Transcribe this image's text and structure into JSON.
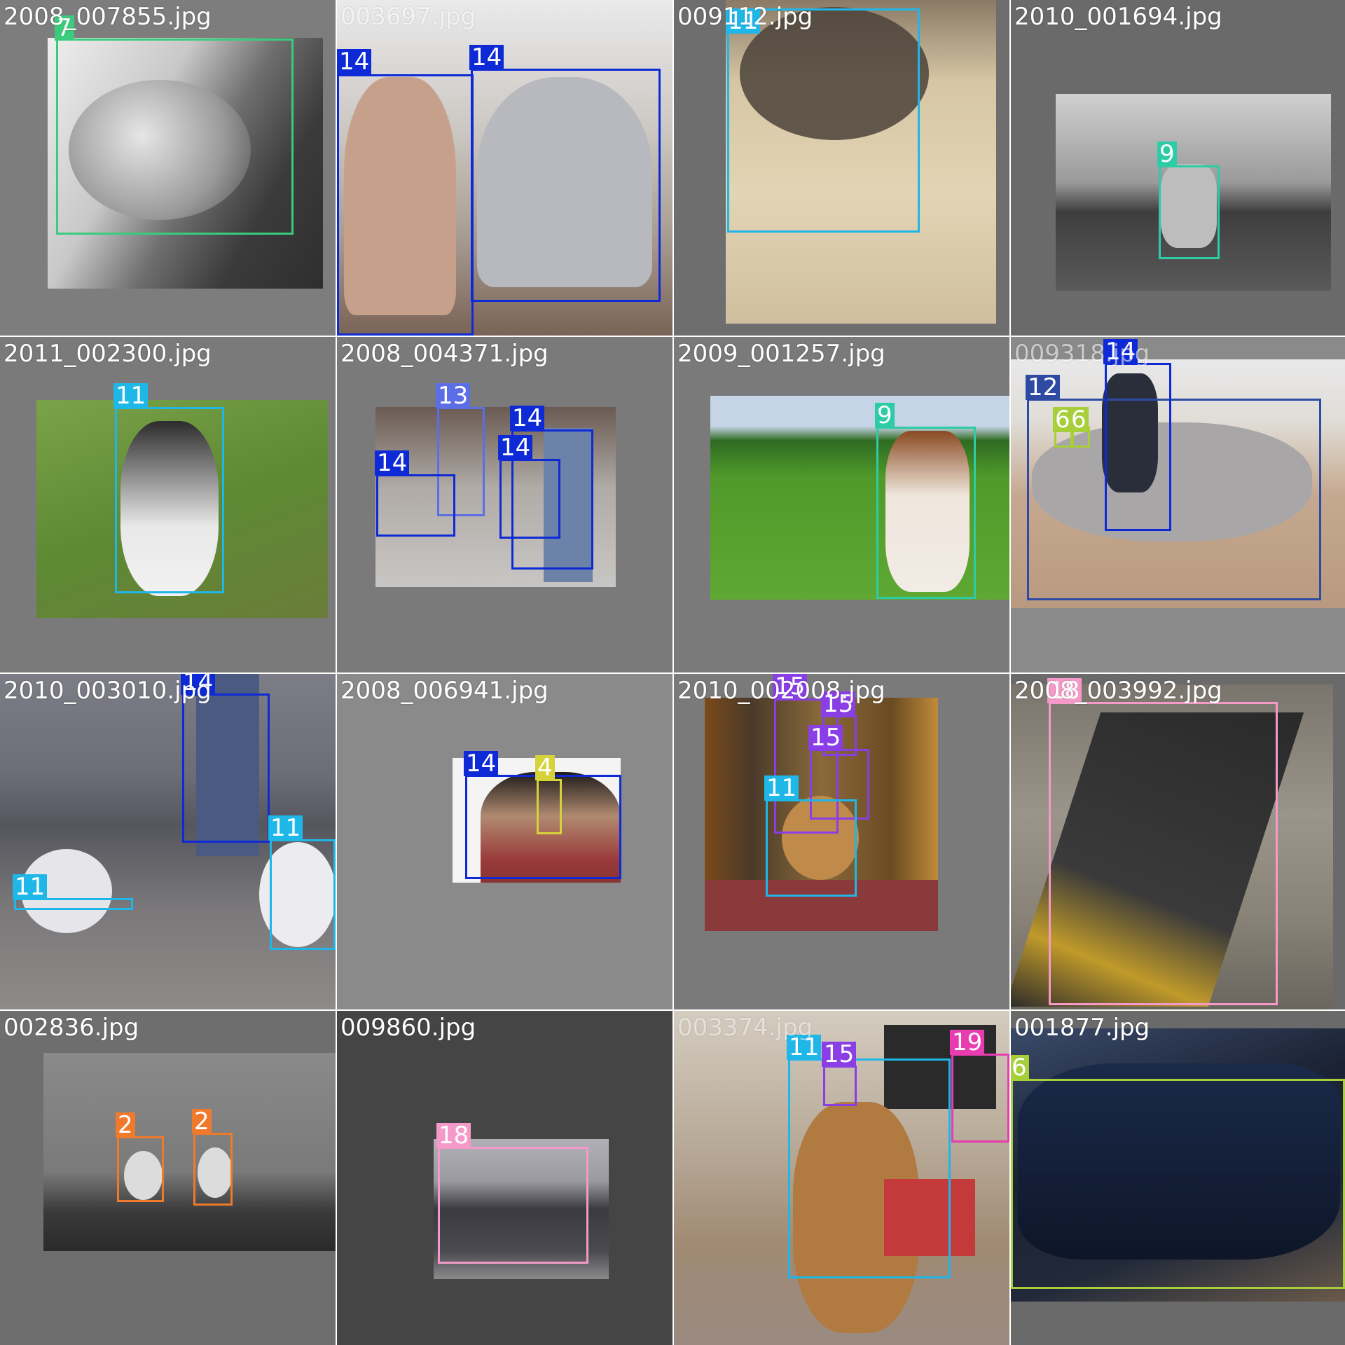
{
  "colors": {
    "c2": "#f07a2c",
    "c4": "#d6d23a",
    "c6": "#a6cf3a",
    "c7": "#3ccb7c",
    "c9": "#2ecca6",
    "c11": "#1fb6e8",
    "c12": "#2e4aa3",
    "c13": "#5b6ee6",
    "c14": "#0d2ad6",
    "c15": "#8a3ee6",
    "c18": "#f59ac8",
    "c19": "#e83cb0"
  },
  "tiles": [
    {
      "filename": "2008_007855.jpg",
      "bg": "#7d7d7d",
      "photo": {
        "desc": "cat-closeup",
        "fill": "#bdbdbd"
      },
      "boxes": [
        {
          "label": "7",
          "color": "c7"
        }
      ]
    },
    {
      "filename": "003697.jpg",
      "bg": "#d8dadc",
      "photo": {
        "desc": "two-people-at-table",
        "fill": "#c9c2bb"
      },
      "boxes": [
        {
          "label": "14",
          "color": "c14"
        },
        {
          "label": "14",
          "color": "c14"
        }
      ]
    },
    {
      "filename": "009112.jpg",
      "bg": "#6e6e6e",
      "photo": {
        "desc": "dog-on-bed",
        "fill": "#d9c9a8"
      },
      "boxes": [
        {
          "label": "11",
          "color": "c11"
        }
      ]
    },
    {
      "filename": "2010_001694.jpg",
      "bg": "#6a6a6a",
      "photo": {
        "desc": "cow-in-field-bw",
        "fill": "#8e8e8e"
      },
      "boxes": [
        {
          "label": "9",
          "color": "c9"
        }
      ]
    },
    {
      "filename": "2011_002300.jpg",
      "bg": "#7a7a7a",
      "photo": {
        "desc": "husky-on-grass",
        "fill": "#6b8e3c"
      },
      "boxes": [
        {
          "label": "11",
          "color": "c11"
        }
      ]
    },
    {
      "filename": "2008_004371.jpg",
      "bg": "#7a7a7a",
      "photo": {
        "desc": "motorbike-street",
        "fill": "#9a9a9a"
      },
      "boxes": [
        {
          "label": "13",
          "color": "c13"
        },
        {
          "label": "14",
          "color": "c14"
        },
        {
          "label": "14",
          "color": "c14"
        },
        {
          "label": "14",
          "color": "c14"
        }
      ]
    },
    {
      "filename": "2009_001257.jpg",
      "bg": "#7a7a7a",
      "photo": {
        "desc": "cow-in-green-field",
        "fill": "#4f8a2a"
      },
      "boxes": [
        {
          "label": "9",
          "color": "c9"
        }
      ]
    },
    {
      "filename": "009318.jpg",
      "bg": "#8a8a8a",
      "photo": {
        "desc": "rider-on-horse",
        "fill": "#b89a82"
      },
      "boxes": [
        {
          "label": "14",
          "color": "c14"
        },
        {
          "label": "12",
          "color": "c12"
        },
        {
          "label": "6",
          "color": "c6"
        },
        {
          "label": "6",
          "color": "c6"
        }
      ]
    },
    {
      "filename": "2010_003010.jpg",
      "bg": "#5f6068",
      "photo": {
        "desc": "beach-dogs",
        "fill": "#6f6f78"
      },
      "boxes": [
        {
          "label": "14",
          "color": "c14"
        },
        {
          "label": "11",
          "color": "c11"
        },
        {
          "label": "11",
          "color": "c11"
        }
      ]
    },
    {
      "filename": "2008_006941.jpg",
      "bg": "#8a8a8a",
      "photo": {
        "desc": "man-with-bottle",
        "fill": "#f4f4f4"
      },
      "boxes": [
        {
          "label": "14",
          "color": "c14"
        },
        {
          "label": "4",
          "color": "c4"
        }
      ]
    },
    {
      "filename": "2010_002008.jpg",
      "bg": "#7a7a7a",
      "photo": {
        "desc": "dog-and-plants",
        "fill": "#8a5a2a"
      },
      "boxes": [
        {
          "label": "15",
          "color": "c15"
        },
        {
          "label": "15",
          "color": "c15"
        },
        {
          "label": "15",
          "color": "c15"
        },
        {
          "label": "11",
          "color": "c11"
        }
      ]
    },
    {
      "filename": "2008_003992.jpg",
      "bg": "#6a6a6a",
      "photo": {
        "desc": "freight-train",
        "fill": "#7b756c"
      },
      "boxes": [
        {
          "label": "18",
          "color": "c18"
        }
      ]
    },
    {
      "filename": "002836.jpg",
      "bg": "#6e6e6e",
      "photo": {
        "desc": "swans-fog",
        "fill": "#5a5a5a"
      },
      "boxes": [
        {
          "label": "2",
          "color": "c2"
        },
        {
          "label": "2",
          "color": "c2"
        }
      ]
    },
    {
      "filename": "009860.jpg",
      "bg": "#454545",
      "photo": {
        "desc": "rail-car",
        "fill": "#9b9b9f"
      },
      "boxes": [
        {
          "label": "18",
          "color": "c18"
        }
      ]
    },
    {
      "filename": "003374.jpg",
      "bg": "#b7b0a6",
      "photo": {
        "desc": "boxer-dog-living-room",
        "fill": "#b59a7c"
      },
      "boxes": [
        {
          "label": "11",
          "color": "c11"
        },
        {
          "label": "15",
          "color": "c15"
        },
        {
          "label": "19",
          "color": "c19"
        }
      ]
    },
    {
      "filename": "001877.jpg",
      "bg": "#6a6a6a",
      "photo": {
        "desc": "race-car",
        "fill": "#202838"
      },
      "boxes": [
        {
          "label": "6",
          "color": "c6"
        }
      ]
    }
  ]
}
